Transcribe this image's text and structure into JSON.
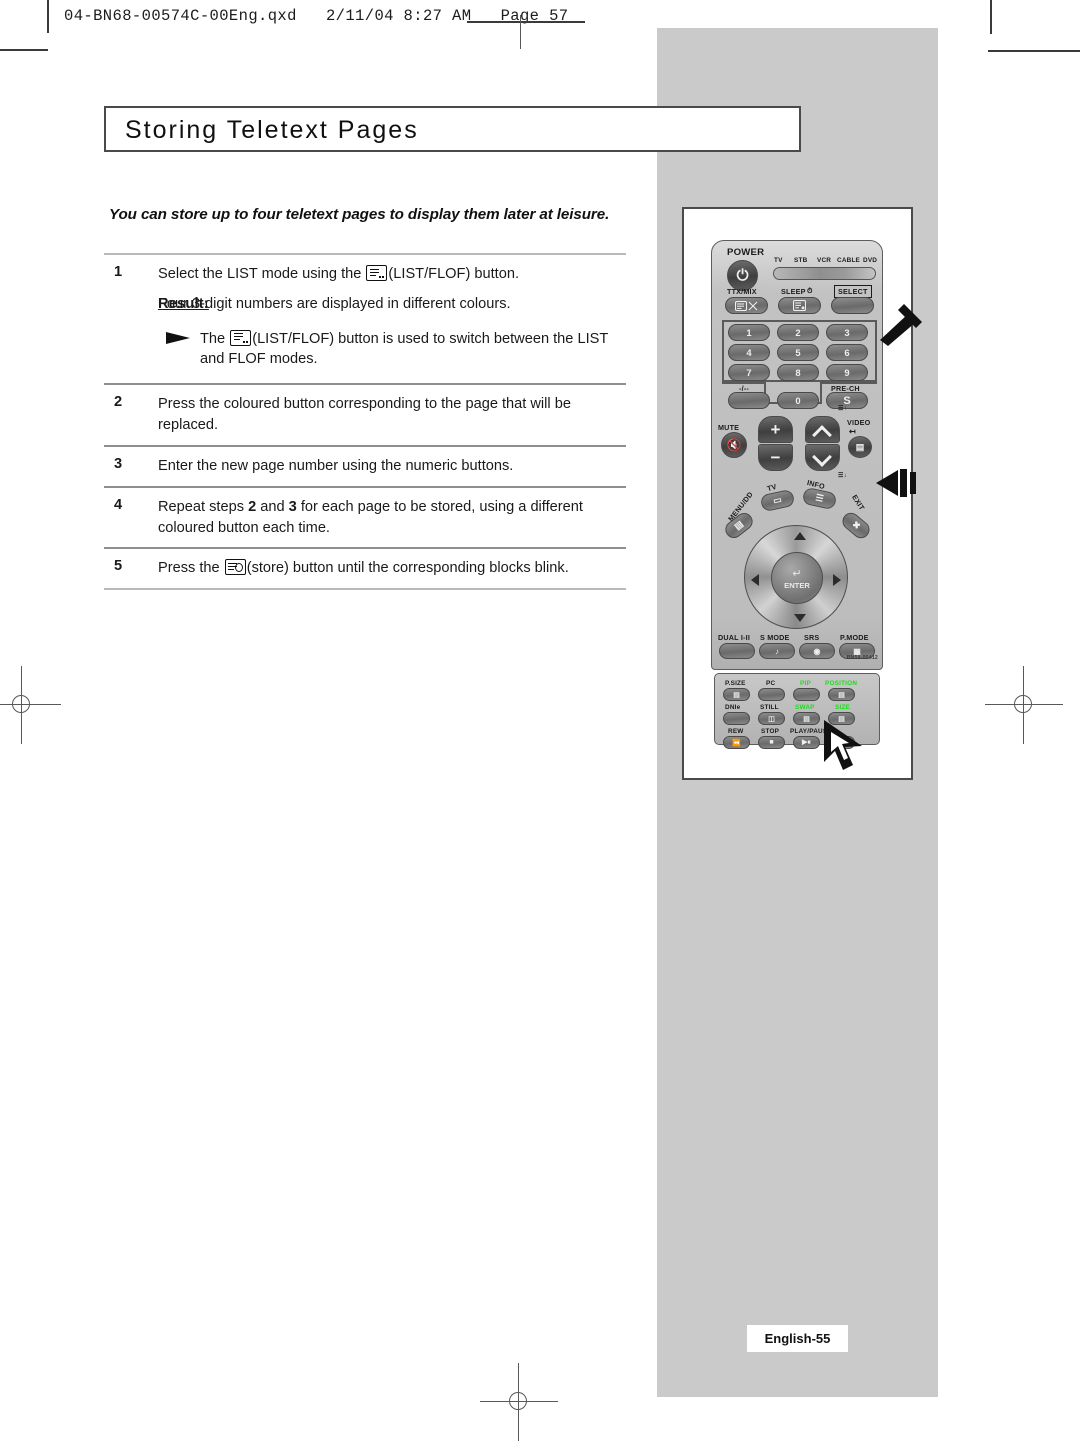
{
  "print_header": {
    "filename_line": "04-BN68-00574C-00Eng.qxd   2/11/04 8:27 AM   Page 57"
  },
  "page": {
    "title": "Storing Teletext Pages",
    "intro": "You can store up to four teletext pages to display them later at leisure.",
    "footer": "English-55"
  },
  "steps": [
    {
      "num": "1",
      "text_before_icon": "Select the LIST mode using the ",
      "icon": "list-flof-icon",
      "text_after_icon": "(LIST/FLOF) button.",
      "result_label": "Result:",
      "result_text": "Four 3-digit numbers are displayed in different colours.",
      "note_before_icon": "The ",
      "note_icon": "list-flof-icon",
      "note_after_icon": "(LIST/FLOF) button is used to switch between the LIST and FLOF modes."
    },
    {
      "num": "2",
      "text": "Press the coloured button corresponding to the page that will be replaced."
    },
    {
      "num": "3",
      "text": "Enter the new page number using the numeric buttons."
    },
    {
      "num": "4",
      "text_a": "Repeat steps ",
      "bold_a": "2",
      "text_b": " and ",
      "bold_b": "3",
      "text_c": " for each page to be stored, using a different coloured button each time."
    },
    {
      "num": "5",
      "text_before_icon": "Press the ",
      "icon": "store-icon",
      "text_after_icon": "(store) button until the corresponding blocks blink."
    }
  ],
  "remote": {
    "model_code": "BN59-00412",
    "power_label": "POWER",
    "mode_labels": [
      "TV",
      "STB",
      "VCR",
      "CABLE",
      "DVD"
    ],
    "row_ttx": [
      {
        "label": "TTX/MIX",
        "icon": "ttx-mix-icon"
      },
      {
        "label": "SLEEP",
        "icon": "sleep-clock-icon"
      },
      {
        "label": "SELECT",
        "icon": "select-icon"
      }
    ],
    "keypad": [
      "1",
      "2",
      "3",
      "4",
      "5",
      "6",
      "7",
      "8",
      "9"
    ],
    "keypad_row4": [
      {
        "label": "-/--",
        "name": "dash-dash-button"
      },
      {
        "label": "0",
        "name": "zero-button"
      },
      {
        "label": "PRE-CH",
        "name": "pre-ch-button"
      }
    ],
    "mute_label": "MUTE",
    "video_label": "VIDEO",
    "volume": [
      "+",
      "−"
    ],
    "channel": [
      "up",
      "down"
    ],
    "tv_label": "TV",
    "info_label": "INFO",
    "menu_label": "MENU/DD",
    "exit_label": "EXIT",
    "enter_label": "ENTER",
    "sound_row": [
      "DUAL I-II",
      "S MODE",
      "SRS",
      "P.MODE"
    ],
    "bottom_rows": [
      [
        {
          "label": "P.SIZE",
          "colour": "#1b1b1b"
        },
        {
          "label": "PC",
          "colour": "#1b1b1b"
        },
        {
          "label": "PIP",
          "colour": "#19e019"
        },
        {
          "label": "POSITION",
          "colour": "#19e019"
        }
      ],
      [
        {
          "label": "DNIe",
          "colour": "#1b1b1b"
        },
        {
          "label": "STILL",
          "colour": "#1b1b1b"
        },
        {
          "label": "SWAP",
          "colour": "#19e019"
        },
        {
          "label": "SIZE",
          "colour": "#19e019"
        }
      ],
      [
        {
          "label": "REW",
          "colour": "#1b1b1b"
        },
        {
          "label": "STOP",
          "colour": "#1b1b1b"
        },
        {
          "label": "PLAY/PAUSE",
          "colour": "#1b1b1b"
        }
      ]
    ]
  },
  "colors": {
    "grey_panel": "#cacaca",
    "rule": "#b9b9b9",
    "green_label": "#19e019",
    "ink": "#1a1a1a"
  }
}
